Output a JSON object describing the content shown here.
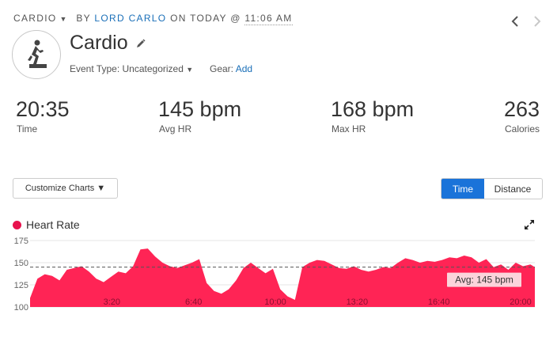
{
  "activity": {
    "type_label": "CARDIO",
    "by_prefix": "BY",
    "author": "LORD CARLO",
    "on_text": "ON TODAY @",
    "time": "11:06 AM",
    "title": "Cardio",
    "event_type_label": "Event Type:",
    "event_type_value": "Uncategorized",
    "gear_label": "Gear:",
    "gear_value": "Add"
  },
  "stats": [
    {
      "value": "20:35",
      "label": "Time"
    },
    {
      "value": "145 bpm",
      "label": "Avg HR"
    },
    {
      "value": "168 bpm",
      "label": "Max HR"
    },
    {
      "value": "263",
      "label": "Calories"
    }
  ],
  "controls": {
    "customize_label": "Customize Charts ▼",
    "toggle": [
      "Time",
      "Distance"
    ],
    "toggle_active": "Time"
  },
  "icons": [
    "person-activity-icon",
    "pencil-icon",
    "chevron-left-icon",
    "chevron-right-icon",
    "expand-icon",
    "caret-down-icon"
  ],
  "colors": {
    "accent": "#1a73d9",
    "heart_rate": "#ff2455",
    "link": "#1a6fb8"
  },
  "chart_data": {
    "type": "area",
    "title": "Heart Rate",
    "ylim": [
      100,
      175
    ],
    "yticks": [
      100,
      125,
      150,
      175
    ],
    "xticks": [
      "3:20",
      "6:40",
      "10:00",
      "13:20",
      "16:40",
      "20:00"
    ],
    "xtick_minutes": [
      3.333,
      6.667,
      10,
      13.333,
      16.667,
      20
    ],
    "x_range_minutes": [
      0,
      20.58
    ],
    "average": {
      "value": 145,
      "label": "Avg: 145 bpm"
    },
    "series": [
      {
        "color": "#ff2455",
        "x": [
          0,
          0.3,
          0.6,
          0.9,
          1.2,
          1.5,
          1.8,
          2.1,
          2.4,
          2.7,
          3.0,
          3.3,
          3.6,
          3.9,
          4.2,
          4.5,
          4.8,
          5.1,
          5.4,
          5.7,
          6.0,
          6.3,
          6.6,
          6.9,
          7.2,
          7.5,
          7.8,
          8.1,
          8.4,
          8.7,
          9.0,
          9.3,
          9.6,
          9.9,
          10.2,
          10.5,
          10.8,
          11.1,
          11.4,
          11.7,
          12.0,
          12.3,
          12.6,
          12.9,
          13.2,
          13.5,
          13.8,
          14.1,
          14.4,
          14.7,
          15.0,
          15.3,
          15.6,
          15.9,
          16.2,
          16.5,
          16.8,
          17.1,
          17.4,
          17.7,
          18.0,
          18.3,
          18.6,
          18.9,
          19.2,
          19.5,
          19.8,
          20.1,
          20.4,
          20.58
        ],
        "values": [
          110,
          132,
          137,
          135,
          130,
          142,
          144,
          146,
          140,
          132,
          128,
          134,
          140,
          138,
          146,
          165,
          166,
          157,
          150,
          146,
          144,
          147,
          150,
          154,
          127,
          118,
          115,
          120,
          130,
          144,
          150,
          144,
          138,
          143,
          120,
          112,
          108,
          145,
          150,
          153,
          152,
          148,
          144,
          143,
          146,
          142,
          140,
          142,
          145,
          144,
          150,
          155,
          153,
          150,
          152,
          151,
          153,
          156,
          155,
          158,
          156,
          150,
          154,
          145,
          148,
          142,
          150,
          146,
          148,
          145
        ]
      }
    ]
  }
}
